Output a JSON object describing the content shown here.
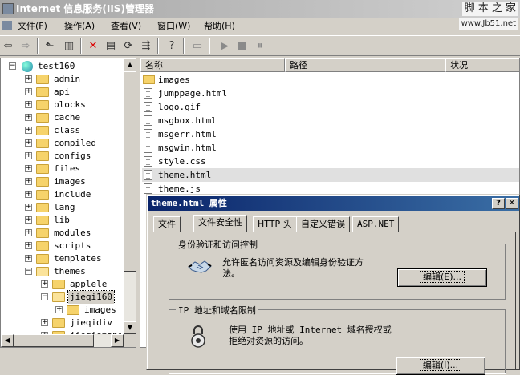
{
  "window": {
    "title": "Internet 信息服务(IIS)管理器"
  },
  "watermark": {
    "line1": "脚 本 之 家",
    "line2": "www.Jb51.net"
  },
  "menu": [
    "文件(F)",
    "操作(A)",
    "查看(V)",
    "窗口(W)",
    "帮助(H)"
  ],
  "tree": {
    "root": "test160",
    "items": [
      "admin",
      "api",
      "blocks",
      "cache",
      "class",
      "compiled",
      "configs",
      "files",
      "images",
      "include",
      "lang",
      "lib",
      "modules",
      "scripts",
      "templates",
      "themes"
    ],
    "themes_children": [
      "applele",
      "jieqi160",
      "jieqidiv",
      "jieqistand"
    ],
    "jieqi160_children": [
      "images"
    ]
  },
  "list": {
    "columns": [
      "名称",
      "路径",
      "状况"
    ],
    "rows": [
      "images",
      "jumppage.html",
      "logo.gif",
      "msgbox.html",
      "msgerr.html",
      "msgwin.html",
      "style.css",
      "theme.html",
      "theme.js"
    ]
  },
  "dialog": {
    "title": "theme.html 属性",
    "tabs": [
      "文件",
      "文件安全性",
      "HTTP 头",
      "自定义错误",
      "ASP.NET"
    ],
    "group1": {
      "title": "身份验证和访问控制",
      "text1": "允许匿名访问资源及编辑身份验证方",
      "text2": "法。",
      "button": "编辑(E)..."
    },
    "group2": {
      "title": "IP 地址和域名限制",
      "text1": "使用 IP 地址或 Internet 域名授权或",
      "text2": "拒绝对资源的访问。",
      "button": "编辑(I)..."
    }
  }
}
